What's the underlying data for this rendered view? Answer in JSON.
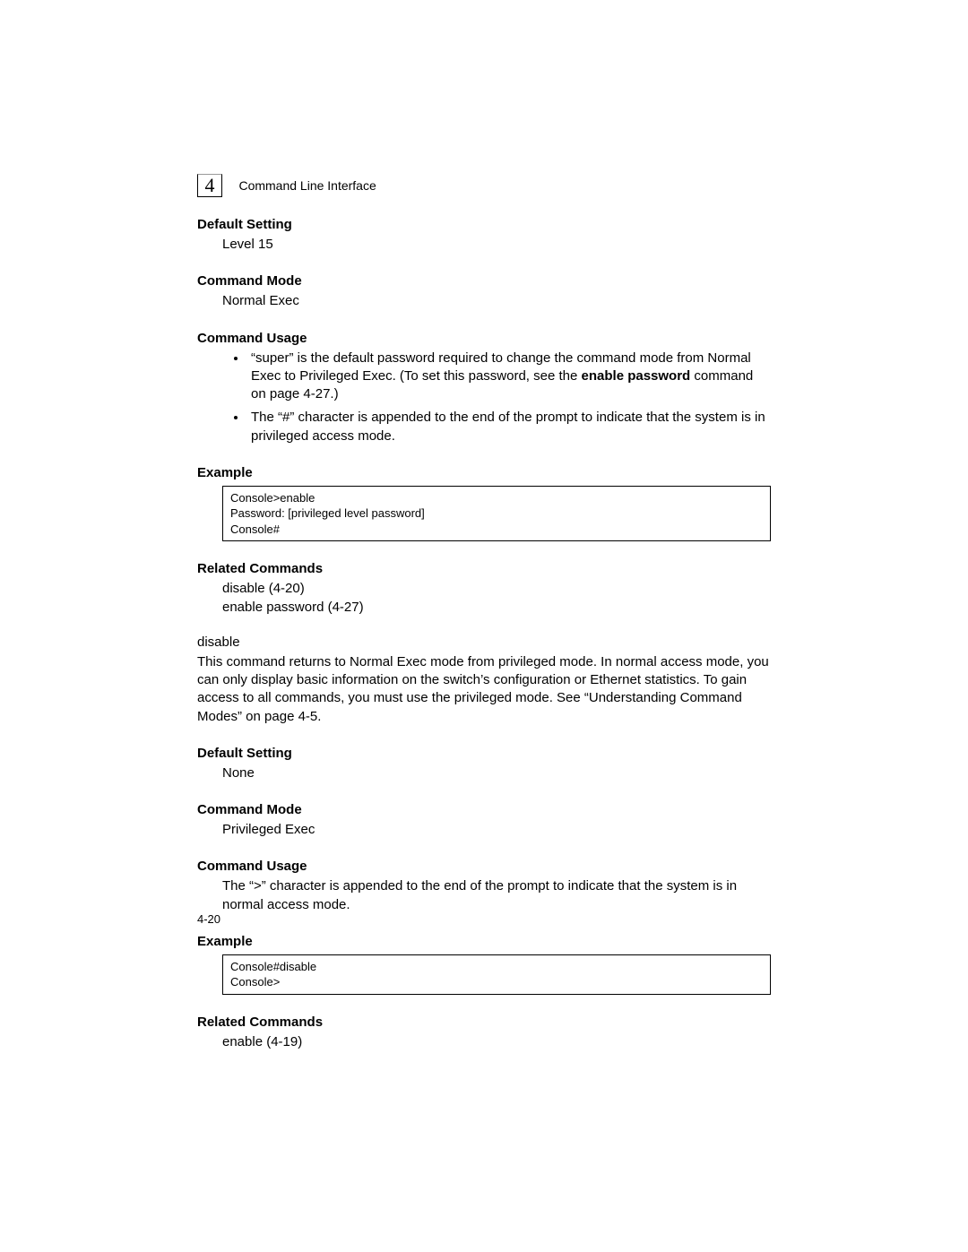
{
  "header": {
    "chapter_number": "4",
    "chapter_title": "Command Line Interface"
  },
  "enable_section": {
    "default_setting_heading": "Default Setting",
    "default_setting_body": "Level 15",
    "command_mode_heading": "Command Mode",
    "command_mode_body": "Normal Exec",
    "command_usage_heading": "Command Usage",
    "usage_item1_a": "“super” is the default password required to change the command mode from Normal Exec to Privileged Exec. (To set this password, see the ",
    "usage_item1_b": "enable password",
    "usage_item1_c": " command on page 4-27.)",
    "usage_item2": "The “#” character is appended to the end of the prompt to indicate that the system is in privileged access mode.",
    "example_heading": "Example",
    "example_code": "Console>enable\nPassword: [privileged level password]\nConsole#",
    "related_heading": "Related Commands",
    "related_body1": "disable (4-20)",
    "related_body2": "enable password (4-27)"
  },
  "disable_section": {
    "cmd_name": "disable",
    "intro": "This command returns to Normal Exec mode from privileged mode. In normal access mode, you can only display basic information on the switch’s configuration or Ethernet statistics. To gain access to all commands, you must use the privileged mode. See “Understanding Command Modes” on page 4-5.",
    "default_setting_heading": "Default Setting",
    "default_setting_body": "None",
    "command_mode_heading": "Command Mode",
    "command_mode_body": "Privileged Exec",
    "command_usage_heading": "Command Usage",
    "command_usage_body": "The “>” character is appended to the end of the prompt to indicate that the system is in normal access mode.",
    "example_heading": "Example",
    "example_code": "Console#disable\nConsole>",
    "related_heading": "Related Commands",
    "related_body": "enable (4-19)"
  },
  "footer": {
    "page_number": "4-20"
  }
}
